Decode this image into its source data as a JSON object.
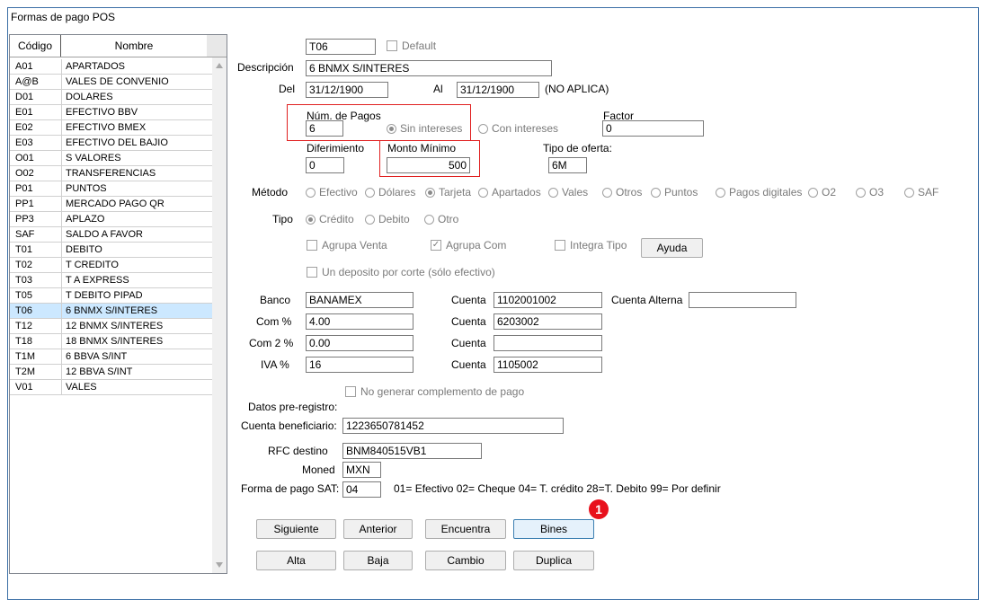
{
  "window": {
    "title": "Formas de pago POS"
  },
  "list": {
    "headers": [
      "Código",
      "Nombre"
    ],
    "rows": [
      {
        "code": "A01",
        "name": "APARTADOS"
      },
      {
        "code": "A@B",
        "name": "VALES DE CONVENIO"
      },
      {
        "code": "D01",
        "name": "DOLARES"
      },
      {
        "code": "E01",
        "name": "EFECTIVO BBV"
      },
      {
        "code": "E02",
        "name": "EFECTIVO BMEX"
      },
      {
        "code": "E03",
        "name": "EFECTIVO DEL BAJIO"
      },
      {
        "code": "O01",
        "name": "S VALORES"
      },
      {
        "code": "O02",
        "name": "TRANSFERENCIAS"
      },
      {
        "code": "P01",
        "name": "PUNTOS"
      },
      {
        "code": "PP1",
        "name": "MERCADO PAGO QR"
      },
      {
        "code": "PP3",
        "name": "APLAZO"
      },
      {
        "code": "SAF",
        "name": "SALDO A FAVOR"
      },
      {
        "code": "T01",
        "name": "DEBITO"
      },
      {
        "code": "T02",
        "name": "T CREDITO"
      },
      {
        "code": "T03",
        "name": "T A EXPRESS"
      },
      {
        "code": "T05",
        "name": "T DEBITO PIPAD"
      },
      {
        "code": "T06",
        "name": "6 BNMX S/INTERES"
      },
      {
        "code": "T12",
        "name": "12 BNMX S/INTERES"
      },
      {
        "code": "T18",
        "name": "18 BNMX S/INTERES"
      },
      {
        "code": "T1M",
        "name": "6 BBVA  S/INT"
      },
      {
        "code": "T2M",
        "name": "12 BBVA S/INT"
      },
      {
        "code": "V01",
        "name": "VALES"
      }
    ],
    "selected_index": 16
  },
  "form": {
    "code": "T06",
    "default_label": "Default",
    "descripcion_label": "Descripción",
    "descripcion": "6 BNMX S/INTERES",
    "del_label": "Del",
    "del": "31/12/1900",
    "al_label": "Al",
    "al": "31/12/1900",
    "no_aplica": "(NO APLICA)",
    "num_pagos_label": "Núm. de Pagos",
    "num_pagos": "6",
    "sin_intereses": "Sin intereses",
    "con_intereses": "Con intereses",
    "factor_label": "Factor",
    "factor": "0",
    "diferimiento_label": "Diferimiento",
    "diferimiento": "0",
    "monto_minimo_label": "Monto Mínimo",
    "monto_minimo": "500",
    "tipo_oferta_label": "Tipo de oferta:",
    "tipo_oferta": "6M",
    "metodo_label": "Método",
    "metodo_options": [
      "Efectivo",
      "Dólares",
      "Tarjeta",
      "Apartados",
      "Vales",
      "Otros",
      "Puntos",
      "Pagos digitales",
      "O2",
      "O3",
      "SAF"
    ],
    "metodo_selected": "Tarjeta",
    "tipo_label": "Tipo",
    "tipo_options": [
      "Crédito",
      "Debito",
      "Otro"
    ],
    "tipo_selected": "Crédito",
    "agrupa_venta": "Agrupa Venta",
    "agrupa_com": "Agrupa Com",
    "integra_tipo": "Integra Tipo",
    "ayuda": "Ayuda",
    "un_deposito": "Un deposito por corte (sólo efectivo)",
    "banco_label": "Banco",
    "banco": "BANAMEX",
    "cuenta_label": "Cuenta",
    "cuenta1": "1102001002",
    "cuenta_alterna_label": "Cuenta Alterna",
    "cuenta_alterna": "",
    "com_label": "Com %",
    "com": "4.00",
    "cuenta2": "6203002",
    "com2_label": "Com 2 %",
    "com2": "0.00",
    "cuenta3": "",
    "iva_label": "IVA %",
    "iva": "16",
    "cuenta4": "1105002",
    "no_generar": "No generar complemento de pago",
    "datos_pre": "Datos pre-registro:",
    "cuenta_benef_label": "Cuenta beneficiario:",
    "cuenta_benef": "1223650781452",
    "rfc_label": "RFC destino",
    "rfc": "BNM840515VB1",
    "moned_label": "Moned",
    "moned": "MXN",
    "forma_sat_label": "Forma de pago SAT:",
    "forma_sat": "04",
    "sat_help": "01= Efectivo   02= Cheque  04= T. crédito  28=T. Debito  99= Por definir"
  },
  "buttons": {
    "siguiente": "Siguiente",
    "anterior": "Anterior",
    "encuentra": "Encuentra",
    "bines": "Bines",
    "alta": "Alta",
    "baja": "Baja",
    "cambio": "Cambio",
    "duplica": "Duplica"
  },
  "badge": "1",
  "colors": {
    "highlight_box": "#e02020",
    "badge": "#e8101c",
    "selected_row": "#cce8ff"
  }
}
